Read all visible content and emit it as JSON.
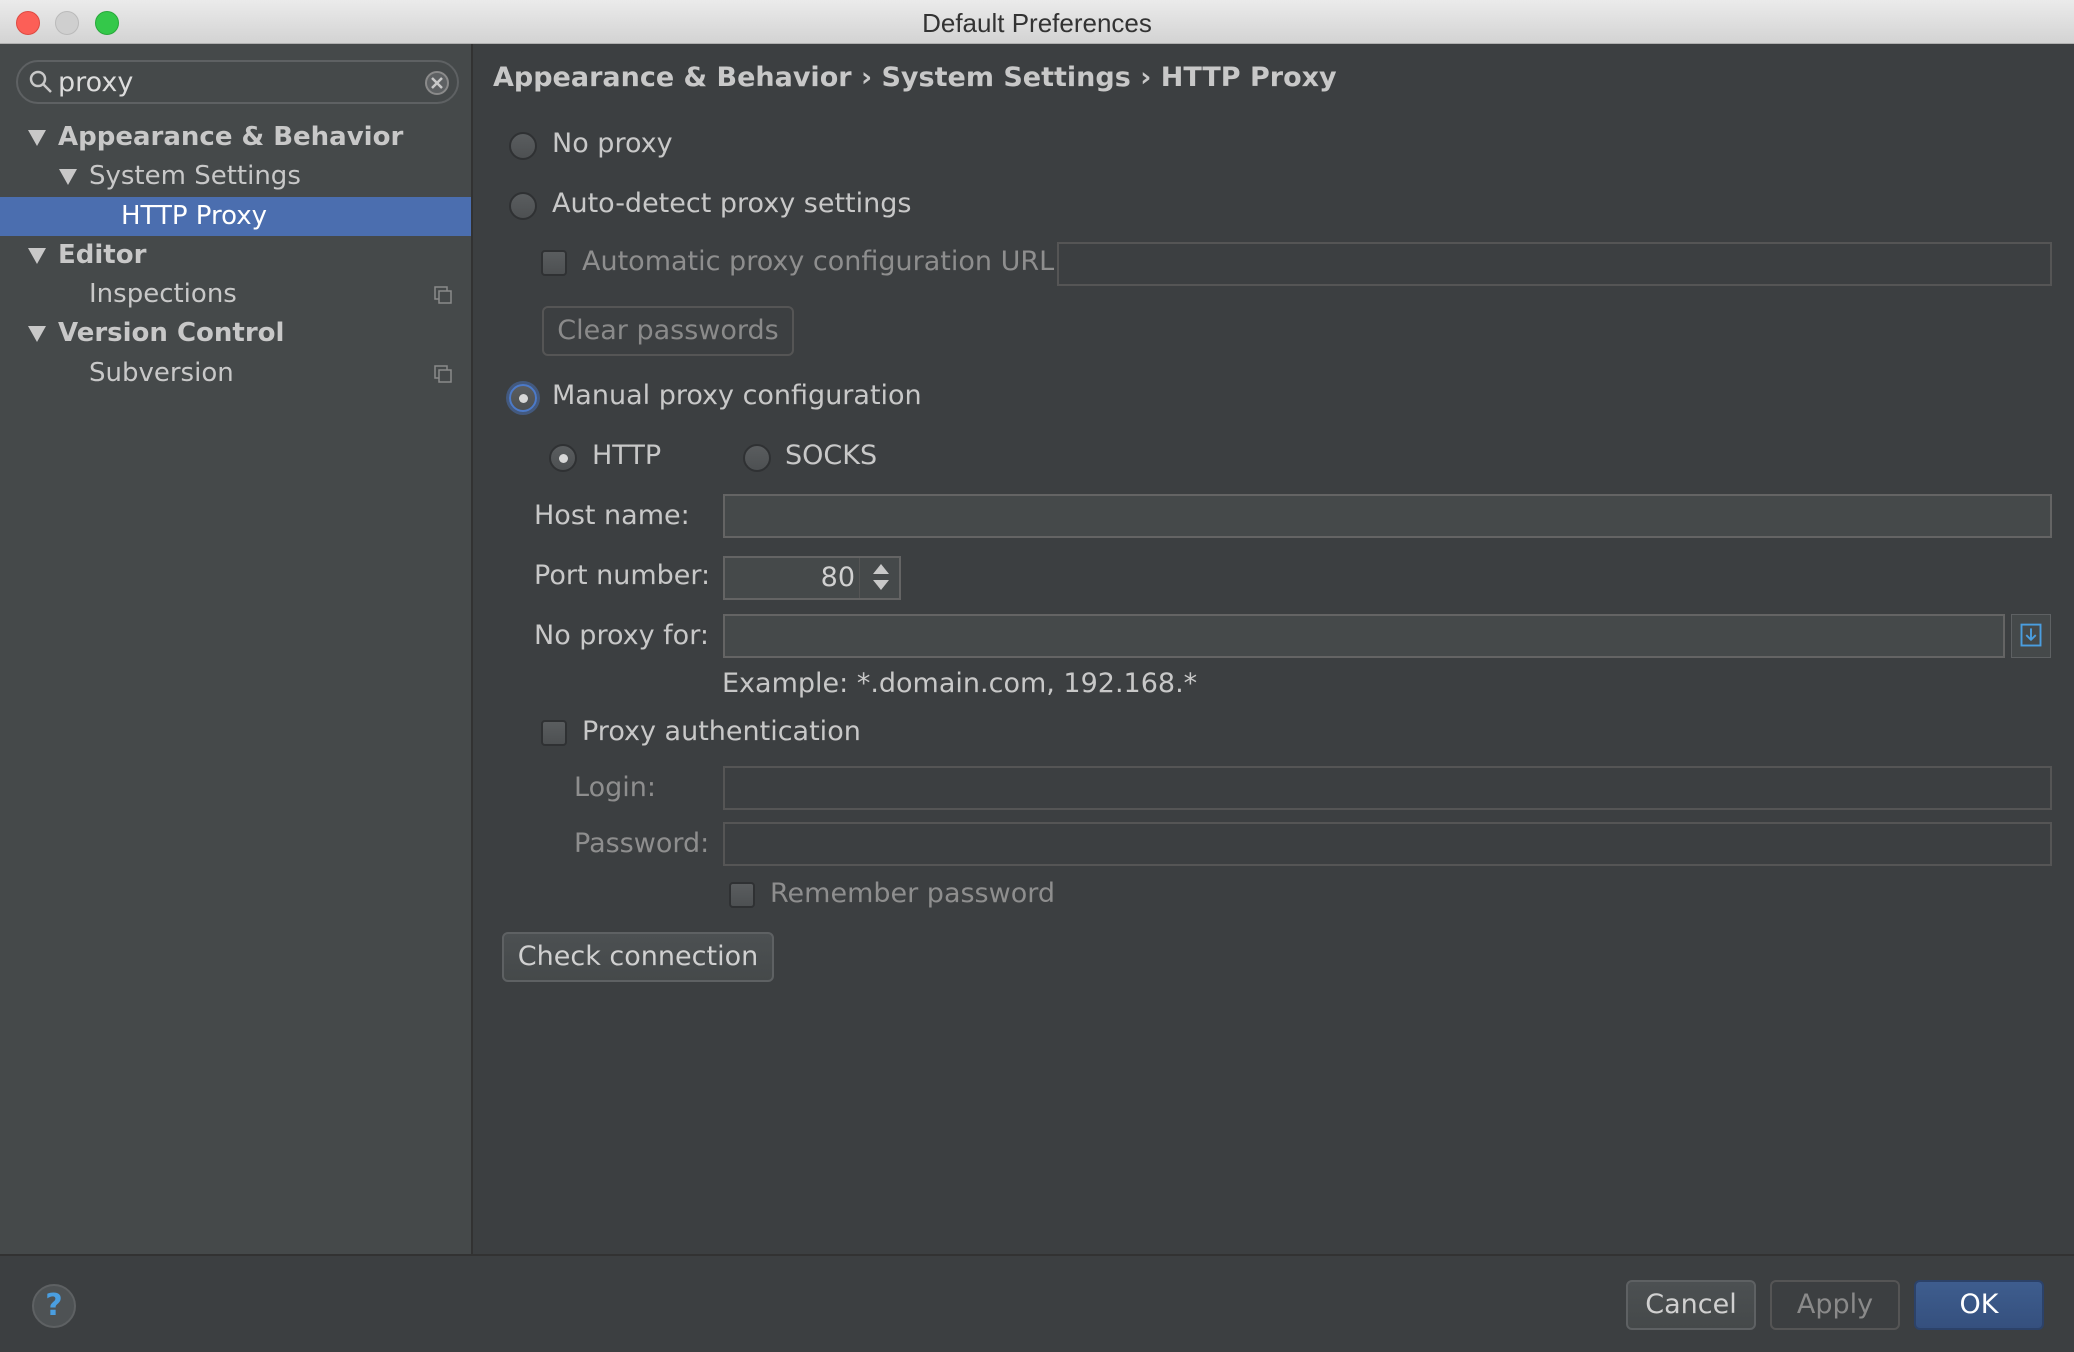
{
  "window": {
    "title": "Default Preferences"
  },
  "search": {
    "value": "proxy"
  },
  "tree": [
    {
      "label": "Appearance & Behavior"
    },
    {
      "label": "System Settings"
    },
    {
      "label": "HTTP Proxy"
    },
    {
      "label": "Editor"
    },
    {
      "label": "Inspections"
    },
    {
      "label": "Version Control"
    },
    {
      "label": "Subversion"
    }
  ],
  "breadcrumb": "Appearance & Behavior › System Settings › HTTP Proxy",
  "options": {
    "no_proxy": "No proxy",
    "auto_detect": "Auto-detect proxy settings",
    "auto_url": "Automatic proxy configuration URL:",
    "clear_passwords": "Clear passwords",
    "manual": "Manual proxy configuration",
    "http": "HTTP",
    "socks": "SOCKS",
    "host_name": "Host name:",
    "port_number": "Port number:",
    "port_value": "80",
    "no_proxy_for": "No proxy for:",
    "example": "Example: *.domain.com, 192.168.*",
    "proxy_auth": "Proxy authentication",
    "login": "Login:",
    "password": "Password:",
    "remember_password": "Remember password",
    "check_connection": "Check connection"
  },
  "footer": {
    "help": "?",
    "cancel": "Cancel",
    "apply": "Apply",
    "ok": "OK"
  },
  "colors": {
    "accent": "#4b6eaf",
    "background": "#3c3f41",
    "sidebar": "#45494a"
  }
}
